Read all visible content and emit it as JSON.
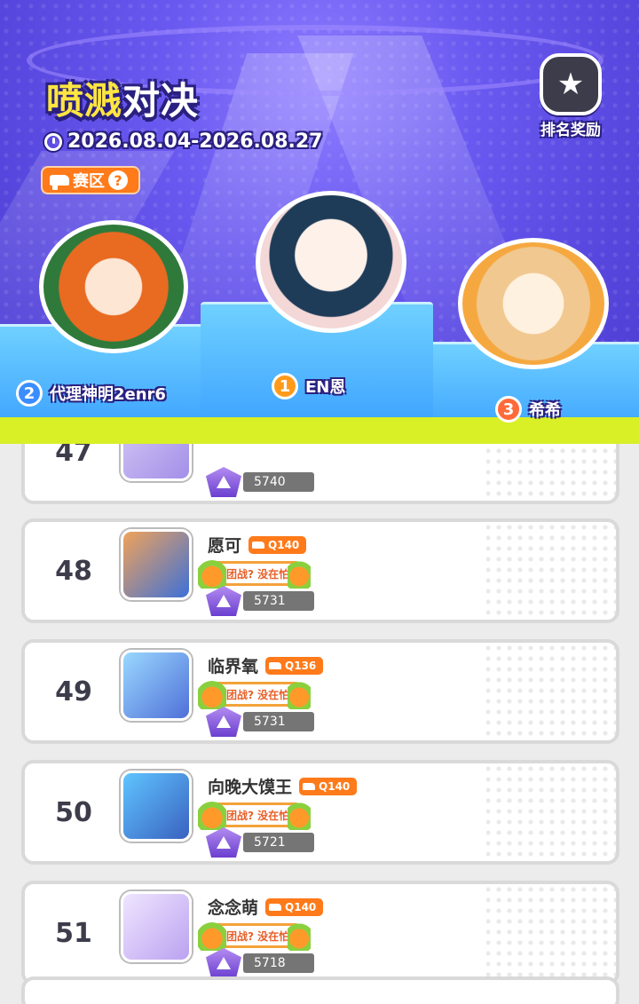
{
  "header": {
    "title_main": "喷溅",
    "title_rest": "对决",
    "date_range": "2026.08.04-2026.08.27",
    "zone_label": "赛区",
    "zone_help": "?",
    "reward_label": "排名奖励"
  },
  "podium": [
    {
      "rank": "1",
      "name": "EN恩"
    },
    {
      "rank": "2",
      "name": "代理神明2enr6"
    },
    {
      "rank": "3",
      "name": "希希"
    }
  ],
  "rows": [
    {
      "rank": "47",
      "name": "",
      "q": "",
      "team": "",
      "score": "5740"
    },
    {
      "rank": "48",
      "name": "愿可",
      "q": "Q140",
      "team": "团战? 没在怕",
      "score": "5731"
    },
    {
      "rank": "49",
      "name": "临界氧",
      "q": "Q136",
      "team": "团战? 没在怕",
      "score": "5731"
    },
    {
      "rank": "50",
      "name": "向晚大馍王",
      "q": "Q140",
      "team": "团战? 没在怕",
      "score": "5721"
    },
    {
      "rank": "51",
      "name": "念念萌",
      "q": "Q140",
      "team": "团战? 没在怕",
      "score": "5718"
    }
  ],
  "colors": {
    "accent": "#ff7a1a",
    "slime": "#d9ef26",
    "hero_bg": "#5a49e0"
  }
}
